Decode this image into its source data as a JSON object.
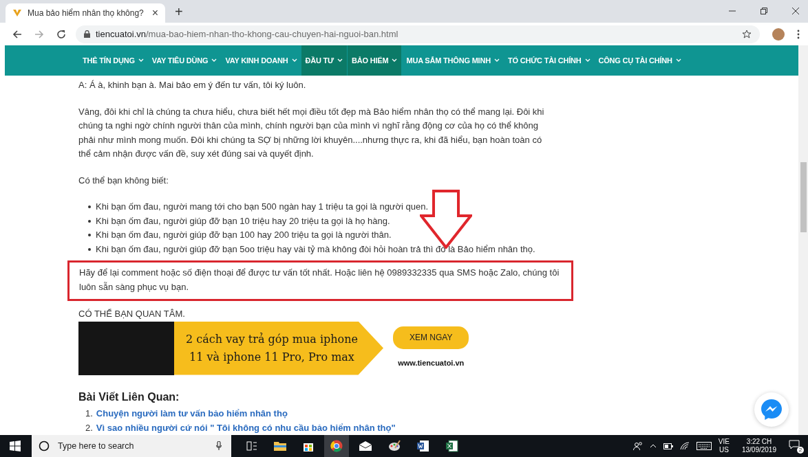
{
  "browser": {
    "tab": {
      "title": "Mua bảo hiểm nhân thọ không?",
      "close": "×"
    },
    "new_tab": "+",
    "url": {
      "domain": "tiencuatoi.vn",
      "path": "/mua-bao-hiem-nhan-tho-khong-cau-chuyen-hai-nguoi-ban.html"
    }
  },
  "nav": [
    {
      "label": "THẺ TÍN DỤNG",
      "selected": false
    },
    {
      "label": "VAY TIÊU DÙNG",
      "selected": false
    },
    {
      "label": "VAY KINH DOANH",
      "selected": false
    },
    {
      "label": "ĐẦU TƯ",
      "selected": true
    },
    {
      "label": "BẢO HIỂM",
      "selected": true
    },
    {
      "label": "MUA SẮM THÔNG MINH",
      "selected": false
    },
    {
      "label": "TỔ CHỨC TÀI CHÍNH",
      "selected": false
    },
    {
      "label": "CÔNG CỤ TÀI CHÍNH",
      "selected": false
    }
  ],
  "article": {
    "paragraphs": [
      "A: Á à, khinh bạn à. Mai bảo em ý đến tư vấn, tôi ký luôn.",
      "Vâng, đôi khi chỉ là chúng ta chưa hiểu, chưa biết hết mọi điều tốt đẹp mà Bảo hiểm nhân thọ có thể mang lại. Đôi khi chúng ta nghi ngờ chính người thân của mình, chính người bạn của mình vì nghĩ rằng động cơ của họ có thể không phải như mình mong muốn. Đôi khi chúng ta SỢ bị những lời khuyên....nhưng thực ra, khi đã hiểu, bạn hoàn toàn có thể cảm nhận được vấn đề, suy xét đúng sai và quyết định.",
      "Có thể bạn không biết:"
    ],
    "bullets": [
      "Khi bạn ốm đau, người mang tới cho bạn 500 ngàn hay 1 triệu ta gọi là người quen.",
      "Khi bạn ốm đau, người giúp đỡ bạn 10 triệu hay 20 triệu ta gọi là họ hàng.",
      "Khi bạn ốm đau, người giúp đỡ bạn 100 hay 200 triệu ta gọi là người thân.",
      "Khi bạn ốm đau, người giúp đỡ bạn 5oo triệu hay vài tỷ mà không đòi hỏi hoàn trả thì đó là Bảo hiểm nhân thọ."
    ],
    "highlight": "Hãy để lại comment hoặc số điện thoại để được tư vấn tốt nhất. Hoặc liên hệ 0989332335 qua SMS hoặc Zalo, chúng tôi luôn sẵn sàng phục vụ bạn.",
    "interest_label": "CÓ THỂ BẠN QUAN TÂM.",
    "banner": {
      "headline": "2 cách vay trả góp mua iphone 11 và iphone 11 Pro, Pro max",
      "button": "XEM NGAY",
      "site": "www.tiencuatoi.vn"
    },
    "related_heading": "Bài Viết Liên Quan:",
    "related": [
      {
        "number": "1.",
        "title": "Chuyện người làm tư vấn bảo hiểm nhân thọ"
      },
      {
        "number": "2.",
        "title": "Vì sao nhiều người cứ nói \" Tôi không có nhu cầu bảo hiểm nhân thọ\""
      }
    ]
  },
  "taskbar": {
    "search_placeholder": "Type here to search",
    "language": "VIE",
    "region": "US",
    "time": "3:22 CH",
    "date": "13/09/2019",
    "notifications": "2"
  }
}
